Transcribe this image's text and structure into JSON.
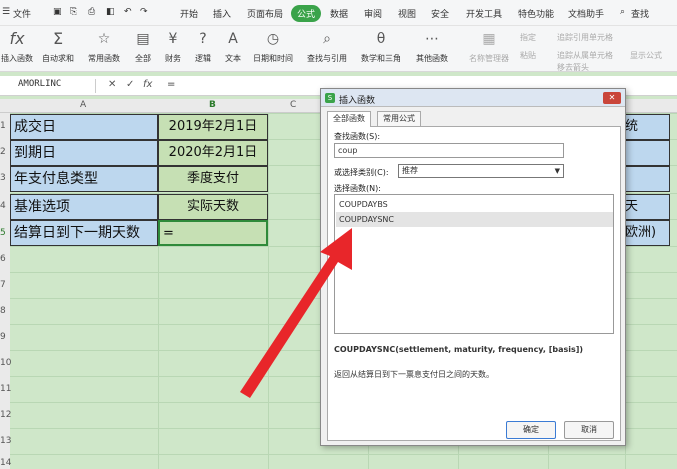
{
  "menu": [
    "文件",
    "开始",
    "插入",
    "页面布局",
    "公式",
    "数据",
    "审阅",
    "视图",
    "安全",
    "开发工具",
    "特色功能",
    "文档助手",
    "查找"
  ],
  "ribbon": {
    "insert_fn": "插入函数",
    "autosum": "自动求和",
    "common": "常用函数",
    "all": "全部",
    "finance": "财务",
    "logic": "逻辑",
    "text": "文本",
    "datetime": "日期和时间",
    "lookup": "查找与引用",
    "math": "数学和三角",
    "other": "其他函数",
    "namemgr": "名称管理器",
    "specify": "指定",
    "paste": "粘贴",
    "trace_prec": "追踪引用单元格",
    "trace_dep": "追踪从属单元格",
    "remove_arrows": "移去箭头",
    "show_formula": "显示公式"
  },
  "formula_bar": {
    "name": "AMORLINC",
    "fx": "fx",
    "value": "="
  },
  "columns": {
    "a": "A",
    "b": "B",
    "c": "C"
  },
  "rows": [
    "1",
    "2",
    "3",
    "4",
    "5",
    "6",
    "7",
    "8",
    "9",
    "10",
    "11",
    "12",
    "13",
    "14"
  ],
  "cells": {
    "a": [
      "成交日",
      "到期日",
      "年支付息类型",
      "基准选项",
      "结算日到下一期天数"
    ],
    "b": [
      "2019年2月1日",
      "2020年2月1日",
      "季度支付",
      "实际天数",
      "="
    ],
    "r": [
      "统",
      "",
      "",
      "天",
      "欧洲)"
    ]
  },
  "dialog": {
    "title": "插入函数",
    "tabs": [
      "全部函数",
      "常用公式"
    ],
    "search_label": "查找函数(S):",
    "search_value": "coup",
    "cat_label": "或选择类别(C):",
    "cat_value": "推荐",
    "list_label": "选择函数(N):",
    "functions": [
      "COUPDAYBS",
      "COUPDAYSNC"
    ],
    "signature": "COUPDAYSNC(settlement, maturity, frequency, [basis])",
    "description": "返回从结算日到下一票息支付日之间的天数。",
    "ok": "确定",
    "cancel": "取消"
  },
  "colors": {
    "accent": "#3aa34a",
    "arrow": "#e8262a",
    "header_fill": "#bdd7ee",
    "value_fill": "#c6e0b4"
  }
}
